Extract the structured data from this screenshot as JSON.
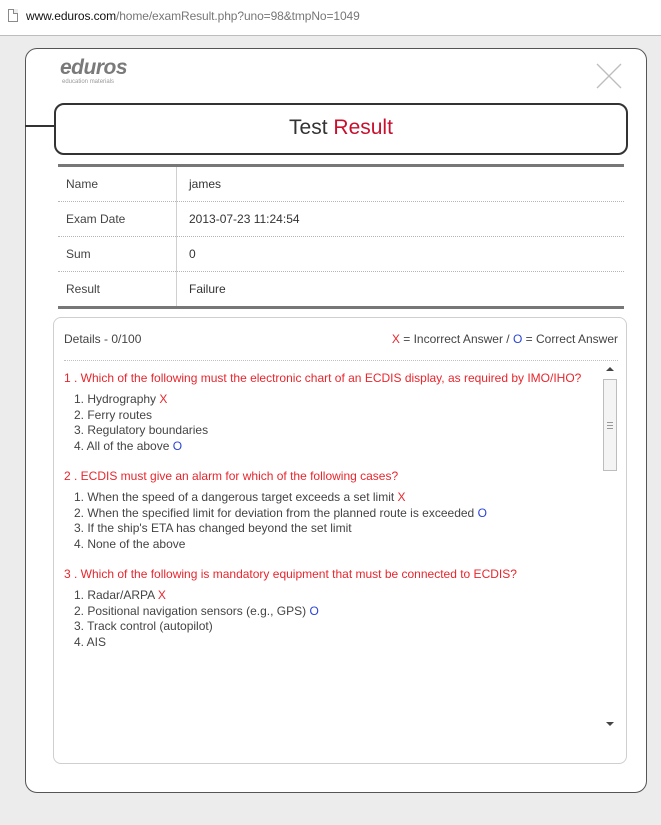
{
  "browser": {
    "url_host": "www.eduros.com",
    "url_path": "/home/examResult.php?uno=98&tmpNo=1049"
  },
  "logo": {
    "brand": "eduros",
    "tagline": "education materials"
  },
  "title": {
    "prefix": "Test",
    "accent": "Result"
  },
  "info": [
    {
      "label": "Name",
      "value": "james"
    },
    {
      "label": "Exam Date",
      "value": "2013-07-23 11:24:54"
    },
    {
      "label": "Sum",
      "value": "0"
    },
    {
      "label": "Result",
      "value": "Failure"
    }
  ],
  "details": {
    "heading": "Details - 0/100",
    "legend": {
      "x": "X",
      "x_text": " = Incorrect Answer / ",
      "o": "O",
      "o_text": " = Correct Answer"
    }
  },
  "questions": [
    {
      "text": "1 . Which of the following must the electronic chart of an ECDIS display, as required by IMO/IHO?",
      "options": [
        {
          "text": "1.  Hydrography",
          "mark": "X"
        },
        {
          "text": "2.  Ferry routes",
          "mark": ""
        },
        {
          "text": "3.  Regulatory boundaries",
          "mark": ""
        },
        {
          "text": "4.  All of the above",
          "mark": "O"
        }
      ]
    },
    {
      "text": "2 . ECDIS must give an alarm for which of the following cases?",
      "options": [
        {
          "text": "1.  When the speed of a dangerous target exceeds a set limit",
          "mark": "X"
        },
        {
          "text": "2.  When the specified limit for deviation from the planned route is exceeded",
          "mark": "O"
        },
        {
          "text": "3.  If the ship's ETA has changed beyond the set limit",
          "mark": ""
        },
        {
          "text": "4.  None of the above",
          "mark": ""
        }
      ]
    },
    {
      "text": "3 . Which of the following is mandatory equipment that must be connected to ECDIS?",
      "options": [
        {
          "text": "1.  Radar/ARPA",
          "mark": "X"
        },
        {
          "text": "2.  Positional navigation sensors (e.g., GPS)",
          "mark": "O"
        },
        {
          "text": "3.  Track control (autopilot)",
          "mark": ""
        },
        {
          "text": "4.  AIS",
          "mark": ""
        }
      ]
    }
  ],
  "colors": {
    "accent_red": "#c8102e",
    "incorrect": "#e8262d",
    "correct": "#2a43d6"
  }
}
